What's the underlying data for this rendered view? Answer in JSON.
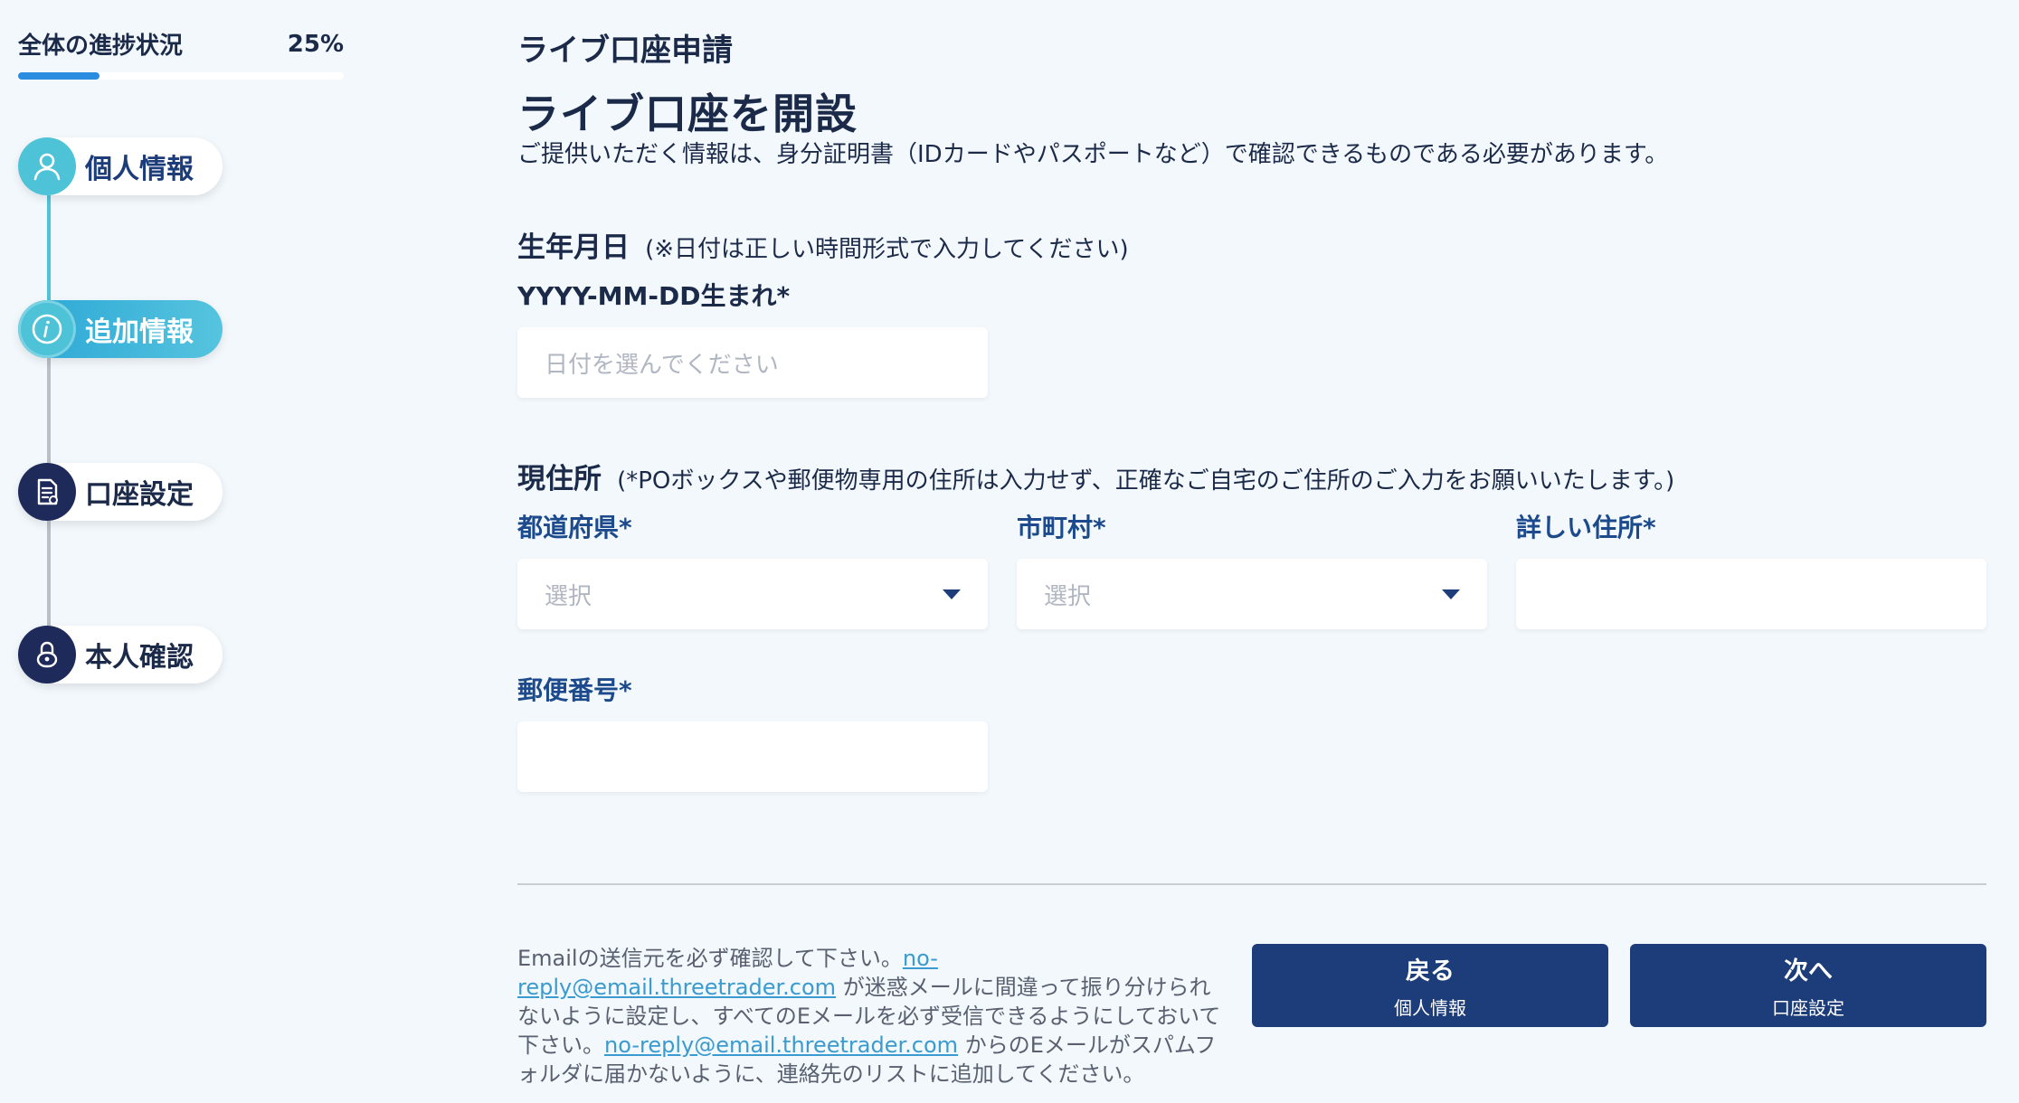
{
  "progress": {
    "label": "全体の進捗状況",
    "percent_text": "25%",
    "fraction": 0.25
  },
  "steps": [
    {
      "label": "個人情報",
      "state": "done",
      "icon": "user-icon"
    },
    {
      "label": "追加情報",
      "state": "active",
      "icon": "info-icon"
    },
    {
      "label": "口座設定",
      "state": "todo",
      "icon": "document-icon"
    },
    {
      "label": "本人確認",
      "state": "todo",
      "icon": "lock-icon"
    }
  ],
  "main": {
    "section_title": "ライブ口座申請",
    "page_title": "ライブ口座を開設",
    "description": "ご提供いただく情報は、身分証明書（IDカードやパスポートなど）で確認できるものである必要があります。"
  },
  "birth": {
    "heading": "生年月日",
    "note": "(※日付は正しい時間形式で入力してください)",
    "format_label": "YYYY-MM-DD生まれ*",
    "placeholder": "日付を選んでください"
  },
  "address": {
    "heading": "現住所",
    "note": "(*POボックスや郵便物専用の住所は入力せず、正確なご自宅のご住所のご入力をお願いいたします。)",
    "prefecture_label": "都道府県*",
    "prefecture_value": "選択",
    "city_label": "市町村*",
    "city_value": "選択",
    "detail_label": "詳しい住所*",
    "detail_value": "",
    "postal_label": "郵便番号*",
    "postal_value": ""
  },
  "footer": {
    "note_part1": "Emailの送信元を必ず確認して下さい。",
    "email": "no-reply@email.threetrader.com",
    "note_part2": " が迷惑メールに間違って振り分けられないように設定し、すべてのEメールを必ず受信できるようにしておいて下さい。",
    "note_part3": " からのEメールがスパムフォルダに届かないように、連絡先のリストに追加してください。",
    "back_label": "戻る",
    "back_sub": "個人情報",
    "next_label": "次へ",
    "next_sub": "口座設定"
  },
  "colors": {
    "primary": "#1c3d7a",
    "accent": "#4ec3d8",
    "progress": "#2a8de0",
    "background": "#f2f8fc"
  }
}
